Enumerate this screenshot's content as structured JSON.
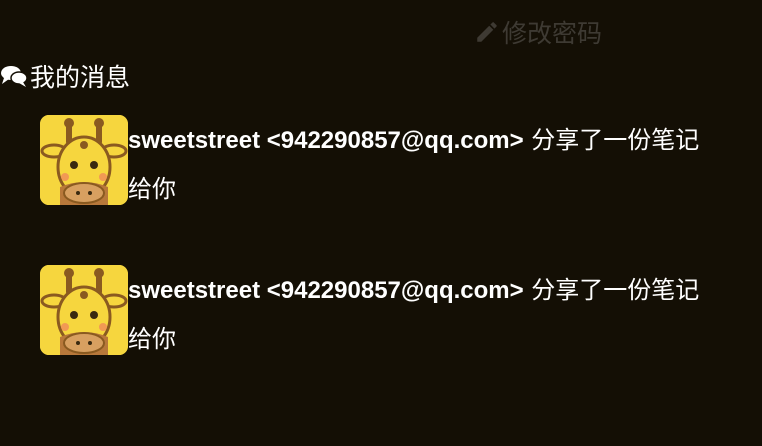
{
  "header": {
    "change_password_label": "修改密码",
    "change_password_icon": "pencil-icon"
  },
  "messages_section": {
    "title": "我的消息",
    "icon": "comments-icon"
  },
  "messages": [
    {
      "avatar": "giraffe-avatar",
      "sender": "sweetstreet <942290857@qq.com>",
      "text": " 分享了一份笔记给你"
    },
    {
      "avatar": "giraffe-avatar",
      "sender": "sweetstreet <942290857@qq.com>",
      "text": " 分享了一份笔记给你"
    }
  ],
  "colors": {
    "background": "#140f05",
    "text": "#ffffff",
    "muted_link": "#3e3a33",
    "avatar_yellow": "#f6d63e"
  }
}
